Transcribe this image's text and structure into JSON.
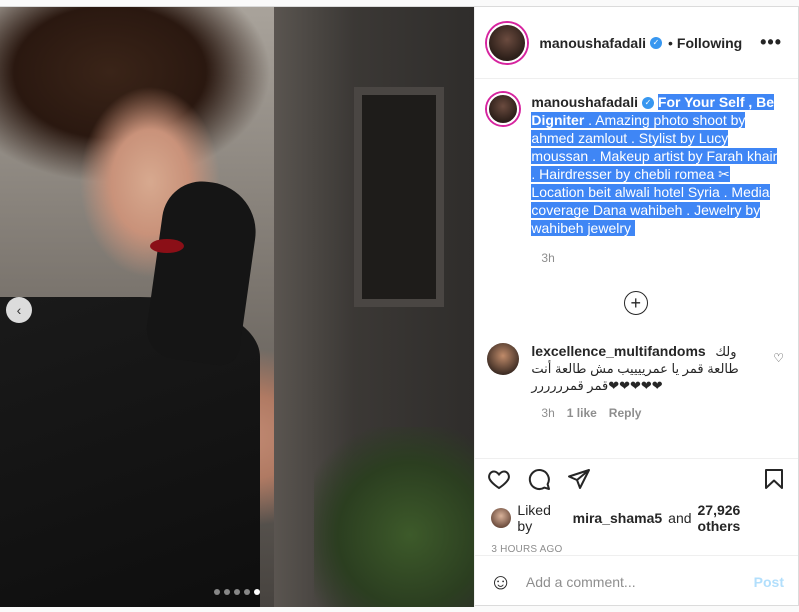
{
  "post": {
    "username": "manoushafadali",
    "follow_separator": "•",
    "follow_status": "Following",
    "more_label": "•••"
  },
  "caption": {
    "username": "manoushafadali",
    "highlighted_bold": "For Your Self , Be Digniter",
    "text": " ⁣⁣. Amazing photo shoot by ahmed zamlout ⁣. Stylist by Lucy moussan ⁣. Makeup artist by Farah khair ⁣. Hairdresser by chebli romea ✂ Location beit alwali hotel Syria ⁣⁣. Media coverage Dana wahibeh ⁣. Jewelry by wahibeh jewelry ⁣",
    "time": "3h"
  },
  "load_more_label": "+",
  "comment": {
    "username": "lexcellence_multifandoms",
    "text": "ولك طالعة قمر يا عمرييييب مش طالعة أنت قمر قمرررررر❤❤❤❤❤",
    "time": "3h",
    "likes": "1 like",
    "reply": "Reply"
  },
  "likes": {
    "prefix": "Liked by",
    "user": "mira_shama5",
    "rest": "and",
    "count": "27,926 others"
  },
  "timestamp": "3 HOURS AGO",
  "composer": {
    "placeholder": "Add a comment...",
    "post_label": "Post"
  },
  "carousel": {
    "prev_label": "‹",
    "total": 5,
    "active_index": 4
  },
  "colors": {
    "highlight": "#3f86f5",
    "verified": "#3897f0",
    "post_disabled": "#b2dffc"
  },
  "icons": [
    "verified-badge-icon",
    "more-options-icon",
    "plus-circle-icon",
    "heart-icon",
    "comment-icon",
    "share-icon",
    "bookmark-icon",
    "emoji-icon",
    "chevron-left-icon"
  ]
}
